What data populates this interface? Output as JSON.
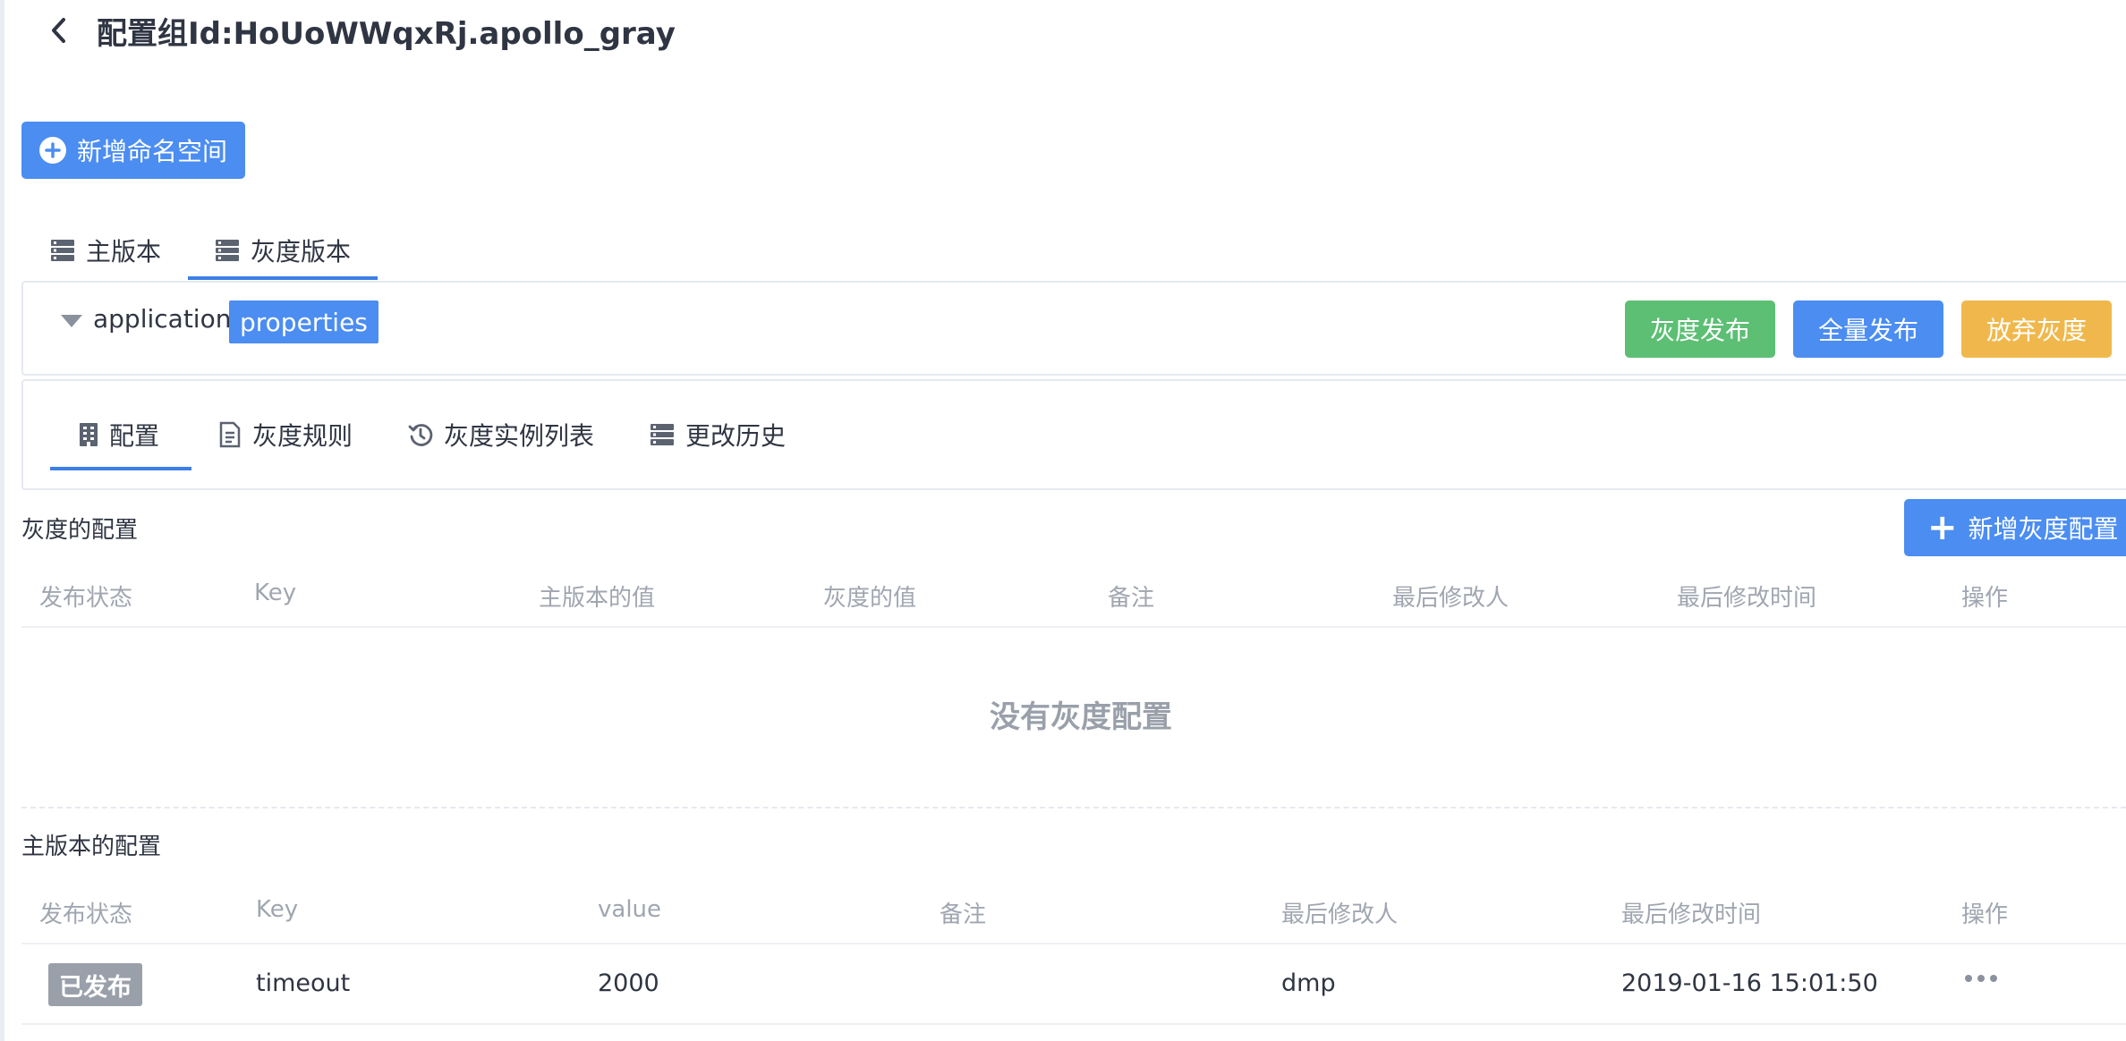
{
  "header": {
    "title": "配置组Id:HoUoWWqxRj.apollo_gray"
  },
  "toolbar": {
    "add_namespace_label": "新增命名空间"
  },
  "version_tabs": [
    {
      "label": "主版本",
      "icon": "server-icon"
    },
    {
      "label": "灰度版本",
      "icon": "server-icon"
    }
  ],
  "namespace": {
    "name": "application",
    "format": "properties",
    "actions": {
      "gray_release": "灰度发布",
      "full_release": "全量发布",
      "abandon_gray": "放弃灰度"
    }
  },
  "sub_tabs": [
    {
      "label": "配置",
      "icon": "building-icon"
    },
    {
      "label": "灰度规则",
      "icon": "document-icon"
    },
    {
      "label": "灰度实例列表",
      "icon": "history-icon"
    },
    {
      "label": "更改历史",
      "icon": "server-icon"
    }
  ],
  "gray_config": {
    "title": "灰度的配置",
    "add_button": "新增灰度配置",
    "columns": [
      "发布状态",
      "Key",
      "主版本的值",
      "灰度的值",
      "备注",
      "最后修改人",
      "最后修改时间",
      "操作"
    ],
    "empty_text": "没有灰度配置"
  },
  "main_config": {
    "title": "主版本的配置",
    "columns": [
      "发布状态",
      "Key",
      "value",
      "备注",
      "最后修改人",
      "最后修改时间",
      "操作"
    ],
    "rows": [
      {
        "status": "已发布",
        "key": "timeout",
        "value": "2000",
        "comment": "",
        "modifier": "dmp",
        "modified_time": "2019-01-16 15:01:50"
      }
    ]
  },
  "colors": {
    "primary": "#4b8df1",
    "success": "#5cbf74",
    "warning": "#f0b84c",
    "tab_active": "#3c7fe6",
    "badge_gray": "#9aa0aa"
  }
}
